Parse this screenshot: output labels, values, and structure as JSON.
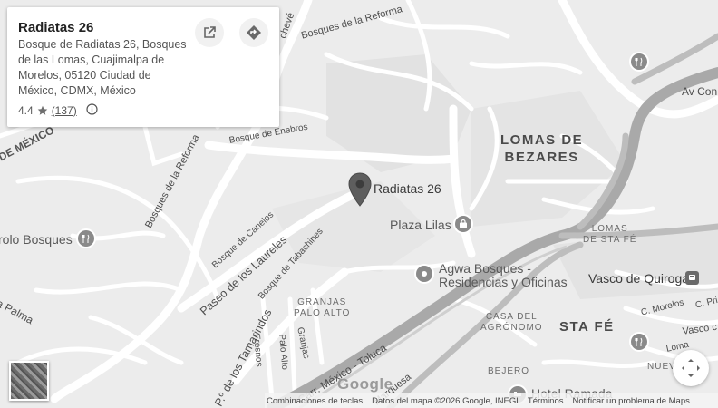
{
  "place_card": {
    "title": "Radiatas 26",
    "address": "Bosque de Radiatas 26, Bosques de las Lomas, Cuajimalpa de Morelos, 05120 Ciudad de México, CDMX, México",
    "rating": "4.4",
    "review_count": "(137)",
    "open_in_maps_icon": "open-external-icon",
    "directions_icon": "directions-icon",
    "info_icon": "info-icon"
  },
  "areas": {
    "lomas_de_bezares_1": "LOMAS DE",
    "lomas_de_bezares_2": "BEZARES",
    "lomas_de_sta_fe_1": "LOMAS",
    "lomas_de_sta_fe_2": "DE STA FÉ",
    "sta_fe": "STA FÉ",
    "granjas_palo_alto_1": "GRANJAS",
    "granjas_palo_alto_2": "PALO ALTO",
    "casa_del_agronomo_1": "CASA DEL",
    "casa_del_agronomo_2": "AGRÓNOMO",
    "bejero": "BEJERO",
    "nuevo": "NUEV",
    "de_mexico": "DE MÉXICO"
  },
  "streets": {
    "bosques_de_la_reforma_top": "Bosques de la Reforma",
    "bosques_de_la_reforma_left": "Bosques de la Reforma",
    "bosque_de_enebros": "Bosque de Enebros",
    "bosque_de_canelos": "Bosque de Canelos",
    "paseo_de_los_laureles": "Paseo de los Laureles",
    "bosque_de_tabachines": "Bosque de Tabachines",
    "paseo_de_los_tamarindos": "P.º de los Tamarindos",
    "fresnos": "Fresnos",
    "palo_alto": "Palo Alto",
    "granjas": "Granjas",
    "carr_mexico_toluca": "Carr. México - Toluca",
    "marquesa": "Marquesa",
    "la_palma": "la Palma",
    "av_con": "Av Con",
    "c_morelos": "C. Morelos",
    "c_pri": "C. Pri",
    "vasco": "Vasco c",
    "loma": "Loma",
    "echeverria": "chevé"
  },
  "pois": {
    "radiatas_26": "Radiatas 26",
    "plaza_lilas": "Plaza Lilas",
    "agwa_1": "Agwa Bosques -",
    "agwa_2": "Residencias y Oficinas",
    "vasco_de_quiroga": "Vasco de Quiroga",
    "hotel_ramada": "Hotel Ramada",
    "rolo_bosques": "rolo Bosques"
  },
  "watermark": "Google",
  "footer": {
    "shortcuts": "Combinaciones de teclas",
    "map_data": "Datos del mapa ©2026 Google, INEGI",
    "terms": "Términos",
    "report": "Notificar un problema de Maps"
  },
  "controls": {
    "layer_toggle_icon": "satellite-layer-icon",
    "fullscreen_icon": "fullscreen-icon"
  }
}
